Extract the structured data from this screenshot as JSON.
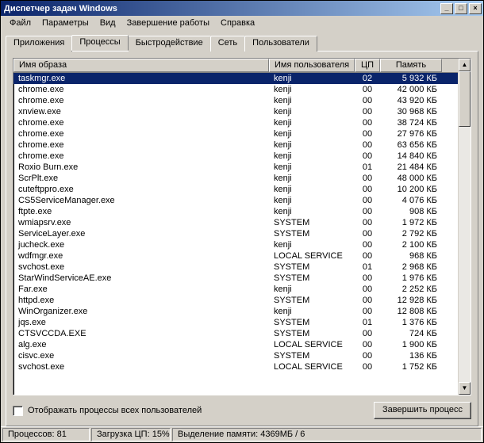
{
  "window": {
    "title": "Диспетчер задач Windows"
  },
  "menu": {
    "items": [
      "Файл",
      "Параметры",
      "Вид",
      "Завершение работы",
      "Справка"
    ]
  },
  "tabs": {
    "items": [
      "Приложения",
      "Процессы",
      "Быстродействие",
      "Сеть",
      "Пользователи"
    ],
    "active_index": 1
  },
  "columns": {
    "name": "Имя образа",
    "user": "Имя пользователя",
    "cpu": "ЦП",
    "mem": "Память"
  },
  "processes": [
    {
      "name": "taskmgr.exe",
      "user": "kenji",
      "cpu": "02",
      "mem": "5 932 КБ",
      "selected": true
    },
    {
      "name": "chrome.exe",
      "user": "kenji",
      "cpu": "00",
      "mem": "42 000 КБ"
    },
    {
      "name": "chrome.exe",
      "user": "kenji",
      "cpu": "00",
      "mem": "43 920 КБ"
    },
    {
      "name": "xnview.exe",
      "user": "kenji",
      "cpu": "00",
      "mem": "30 968 КБ"
    },
    {
      "name": "chrome.exe",
      "user": "kenji",
      "cpu": "00",
      "mem": "38 724 КБ"
    },
    {
      "name": "chrome.exe",
      "user": "kenji",
      "cpu": "00",
      "mem": "27 976 КБ"
    },
    {
      "name": "chrome.exe",
      "user": "kenji",
      "cpu": "00",
      "mem": "63 656 КБ"
    },
    {
      "name": "chrome.exe",
      "user": "kenji",
      "cpu": "00",
      "mem": "14 840 КБ"
    },
    {
      "name": "Roxio Burn.exe",
      "user": "kenji",
      "cpu": "01",
      "mem": "21 484 КБ"
    },
    {
      "name": "ScrPlt.exe",
      "user": "kenji",
      "cpu": "00",
      "mem": "48 000 КБ"
    },
    {
      "name": "cuteftppro.exe",
      "user": "kenji",
      "cpu": "00",
      "mem": "10 200 КБ"
    },
    {
      "name": "CS5ServiceManager.exe",
      "user": "kenji",
      "cpu": "00",
      "mem": "4 076 КБ"
    },
    {
      "name": "ftpte.exe",
      "user": "kenji",
      "cpu": "00",
      "mem": "908 КБ"
    },
    {
      "name": "wmiapsrv.exe",
      "user": "SYSTEM",
      "cpu": "00",
      "mem": "1 972 КБ"
    },
    {
      "name": "ServiceLayer.exe",
      "user": "SYSTEM",
      "cpu": "00",
      "mem": "2 792 КБ"
    },
    {
      "name": "jucheck.exe",
      "user": "kenji",
      "cpu": "00",
      "mem": "2 100 КБ"
    },
    {
      "name": "wdfmgr.exe",
      "user": "LOCAL SERVICE",
      "cpu": "00",
      "mem": "968 КБ"
    },
    {
      "name": "svchost.exe",
      "user": "SYSTEM",
      "cpu": "01",
      "mem": "2 968 КБ"
    },
    {
      "name": "StarWindServiceAE.exe",
      "user": "SYSTEM",
      "cpu": "00",
      "mem": "1 976 КБ"
    },
    {
      "name": "Far.exe",
      "user": "kenji",
      "cpu": "00",
      "mem": "2 252 КБ"
    },
    {
      "name": "httpd.exe",
      "user": "SYSTEM",
      "cpu": "00",
      "mem": "12 928 КБ"
    },
    {
      "name": "WinOrganizer.exe",
      "user": "kenji",
      "cpu": "00",
      "mem": "12 808 КБ"
    },
    {
      "name": "jqs.exe",
      "user": "SYSTEM",
      "cpu": "01",
      "mem": "1 376 КБ"
    },
    {
      "name": "CTSVCCDA.EXE",
      "user": "SYSTEM",
      "cpu": "00",
      "mem": "724 КБ"
    },
    {
      "name": "alg.exe",
      "user": "LOCAL SERVICE",
      "cpu": "00",
      "mem": "1 900 КБ"
    },
    {
      "name": "cisvc.exe",
      "user": "SYSTEM",
      "cpu": "00",
      "mem": "136 КБ"
    },
    {
      "name": "svchost.exe",
      "user": "LOCAL SERVICE",
      "cpu": "00",
      "mem": "1 752 КБ"
    }
  ],
  "show_all_users": {
    "label": "Отображать процессы всех пользователей",
    "checked": false
  },
  "end_process_btn": "Завершить процесс",
  "status": {
    "processes": "Процессов: 81",
    "cpu": "Загрузка ЦП: 15%",
    "mem": "Выделение памяти: 4369МБ / 6"
  }
}
